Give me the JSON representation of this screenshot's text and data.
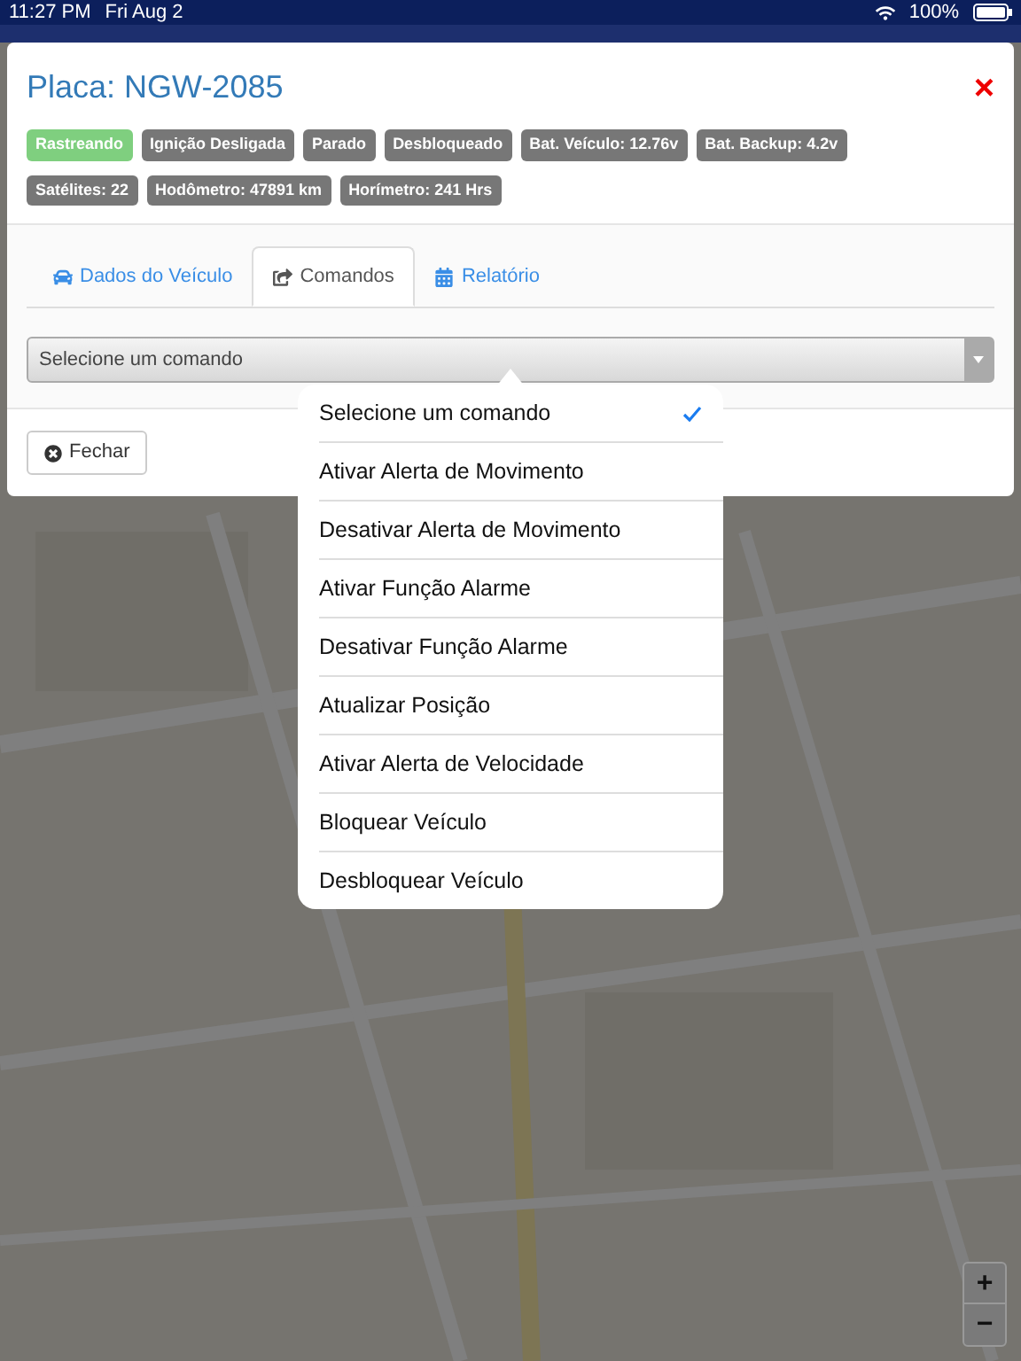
{
  "status_bar": {
    "time": "11:27 PM",
    "date": "Fri Aug 2",
    "battery": "100%"
  },
  "modal": {
    "title": "Placa: NGW-2085",
    "close": "×",
    "badges": [
      {
        "label": "Rastreando",
        "color": "#7fcf7f"
      },
      {
        "label": "Ignição Desligada",
        "color": "#777777"
      },
      {
        "label": "Parado",
        "color": "#777777"
      },
      {
        "label": "Desbloqueado",
        "color": "#777777"
      },
      {
        "label": "Bat. Veículo: 12.76v",
        "color": "#777777"
      },
      {
        "label": "Bat. Backup: 4.2v",
        "color": "#777777"
      },
      {
        "label": "Satélites: 22",
        "color": "#777777"
      },
      {
        "label": "Hodômetro: 47891 km",
        "color": "#777777"
      },
      {
        "label": "Horímetro: 241 Hrs",
        "color": "#777777"
      }
    ],
    "tabs": [
      {
        "label": "Dados do Veículo",
        "selected": false
      },
      {
        "label": "Comandos",
        "selected": true
      },
      {
        "label": "Relatório",
        "selected": false
      }
    ],
    "select": {
      "value": "Selecione um comando"
    },
    "footer_button": "Fechar"
  },
  "dropdown": {
    "options": [
      {
        "label": "Selecione um comando",
        "selected": true
      },
      {
        "label": "Ativar Alerta de Movimento",
        "selected": false
      },
      {
        "label": "Desativar Alerta de Movimento",
        "selected": false
      },
      {
        "label": "Ativar Função Alarme",
        "selected": false
      },
      {
        "label": "Desativar Função Alarme",
        "selected": false
      },
      {
        "label": "Atualizar Posição",
        "selected": false
      },
      {
        "label": "Ativar Alerta de Velocidade",
        "selected": false
      },
      {
        "label": "Bloquear Veículo",
        "selected": false
      },
      {
        "label": "Desbloquear Veículo",
        "selected": false
      }
    ]
  },
  "map_controls": {
    "zoom_in": "+",
    "zoom_out": "−"
  }
}
